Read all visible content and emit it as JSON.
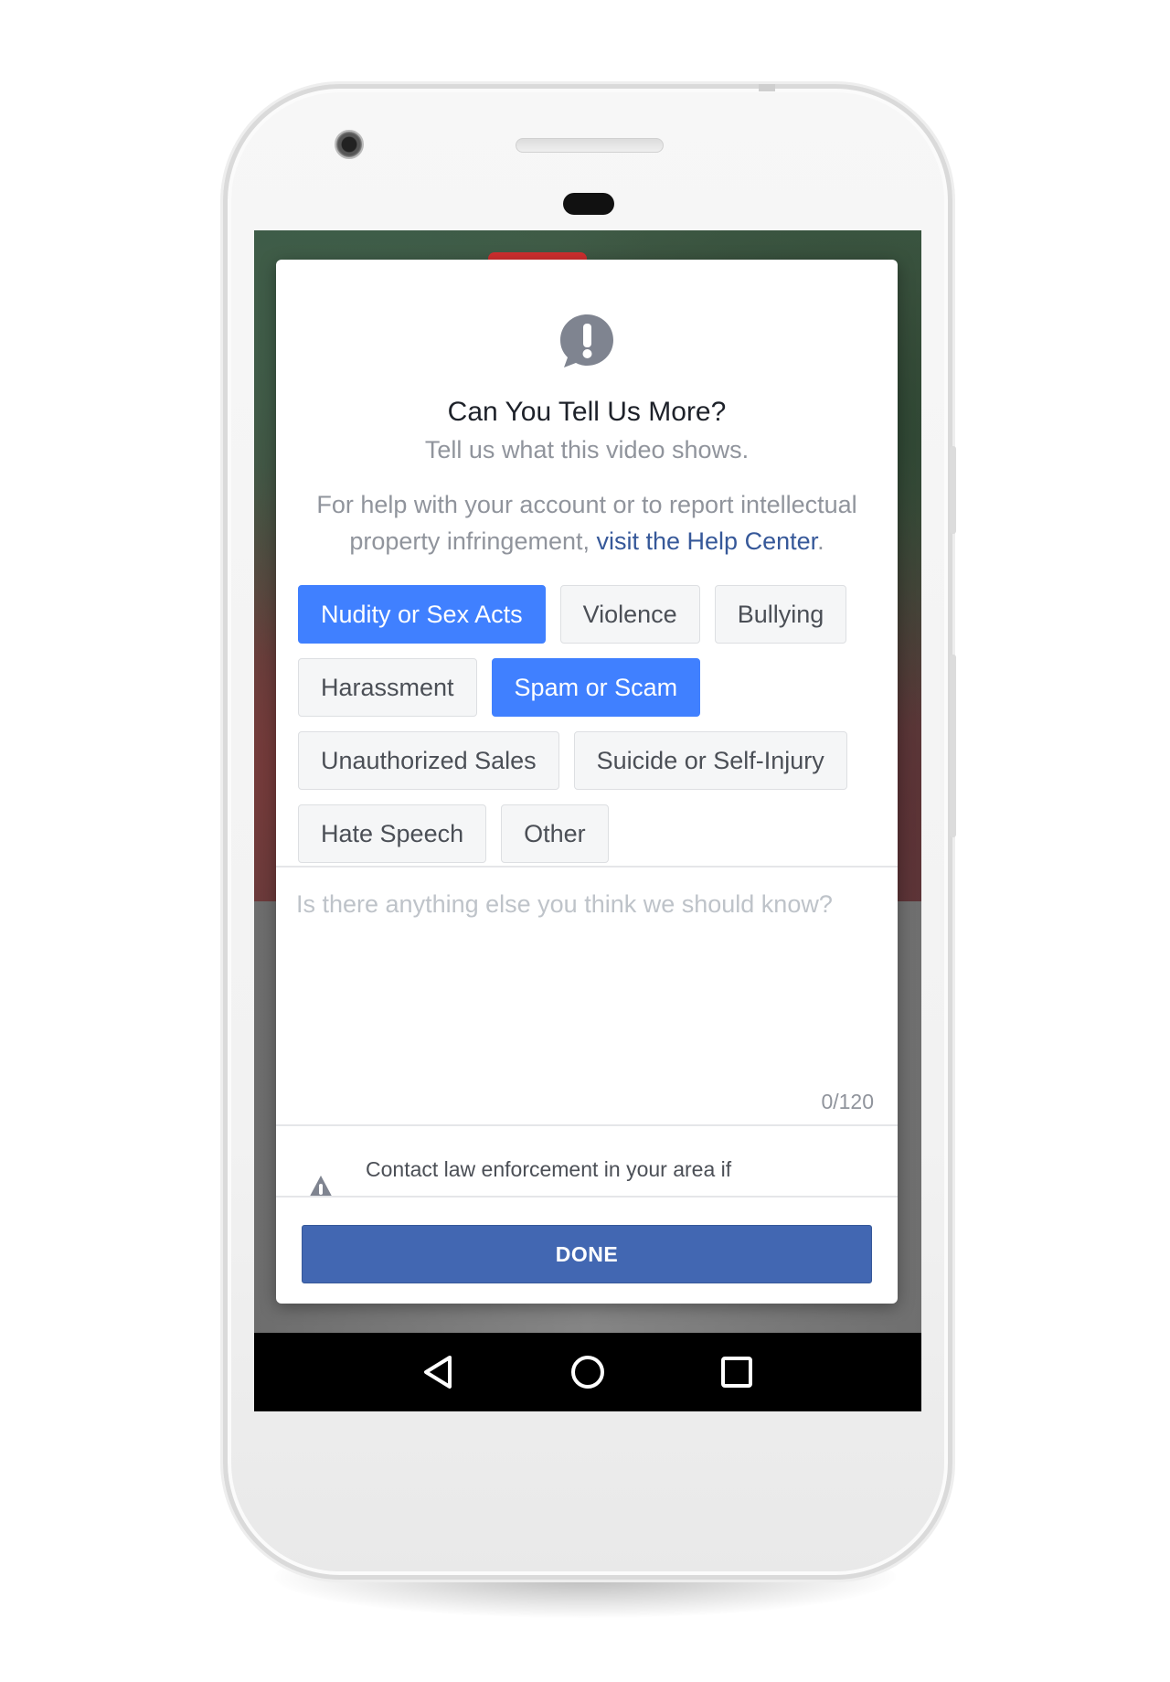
{
  "dialog": {
    "title": "Can You Tell Us More?",
    "subtitle": "Tell us what this video shows.",
    "help_prefix": "For help with your account or to report intellectual property infringement, ",
    "help_link": "visit the Help Center",
    "help_suffix": ".",
    "options": [
      {
        "label": "Nudity or Sex Acts",
        "selected": true
      },
      {
        "label": "Violence",
        "selected": false
      },
      {
        "label": "Bullying",
        "selected": false
      },
      {
        "label": "Harassment",
        "selected": false
      },
      {
        "label": "Spam or Scam",
        "selected": true
      },
      {
        "label": "Unauthorized Sales",
        "selected": false
      },
      {
        "label": "Suicide or Self-Injury",
        "selected": false
      },
      {
        "label": "Hate Speech",
        "selected": false
      },
      {
        "label": "Other",
        "selected": false
      }
    ],
    "details": {
      "placeholder": "Is there anything else you think we should know?",
      "value": "",
      "counter": "0/120"
    },
    "notice_text": "Contact law enforcement in your area if",
    "done_label": "DONE"
  },
  "colors": {
    "selected_chip": "#4080ff",
    "done_button": "#4267b2",
    "link": "#365899"
  },
  "icons": {
    "alert": "exclamation-speech-bubble-icon",
    "warning": "warning-triangle-icon",
    "nav_back": "back-triangle-icon",
    "nav_home": "home-circle-icon",
    "nav_recents": "recents-square-icon"
  }
}
